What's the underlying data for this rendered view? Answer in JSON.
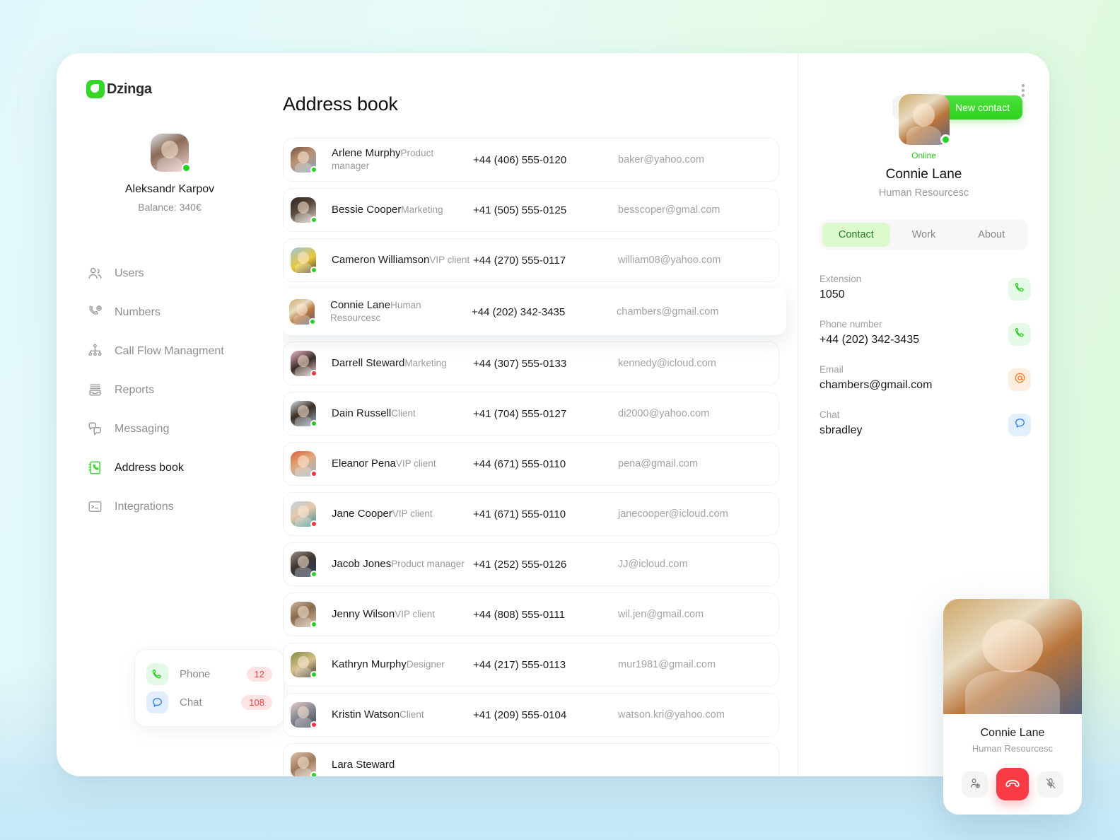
{
  "brand": {
    "name": "Dzinga",
    "accent": "#34d627"
  },
  "profile": {
    "name": "Aleksandr Karpov",
    "balance": "Balance: 340€",
    "status": "online"
  },
  "sidebar": {
    "items": [
      {
        "label": "Users",
        "icon": "users-icon",
        "active": false
      },
      {
        "label": "Numbers",
        "icon": "phone-plus-icon",
        "active": false
      },
      {
        "label": "Call Flow Managment",
        "icon": "call-flow-icon",
        "active": false
      },
      {
        "label": "Reports",
        "icon": "reports-icon",
        "active": false
      },
      {
        "label": "Messaging",
        "icon": "messaging-icon",
        "active": false
      },
      {
        "label": "Address book",
        "icon": "address-book-icon",
        "active": true
      },
      {
        "label": "Integrations",
        "icon": "integrations-icon",
        "active": false
      }
    ],
    "widget": {
      "rows": [
        {
          "label": "Phone",
          "badge": "12",
          "icon": "phone-icon",
          "tone": "green"
        },
        {
          "label": "Chat",
          "badge": "108",
          "icon": "chat-icon",
          "tone": "blue"
        }
      ]
    }
  },
  "header": {
    "title": "Address book",
    "filter_label": "filter-icon",
    "new_contact_label": "New contact"
  },
  "contacts": [
    {
      "name": "Arlene Murphy",
      "role": "Product manager",
      "phone": "+44 (406) 555-0120",
      "email": "baker@yahoo.com",
      "status": "online",
      "avatar": "ph-f1"
    },
    {
      "name": "Bessie Cooper",
      "role": "Marketing",
      "phone": "+41 (505) 555-0125",
      "email": "besscoper@gmal.com",
      "status": "online",
      "avatar": "ph-f2"
    },
    {
      "name": "Cameron Williamson",
      "role": "VIP client",
      "phone": "+44 (270) 555-0117",
      "email": "william08@yahoo.com",
      "status": "online",
      "avatar": "ph-f3"
    },
    {
      "name": "Connie Lane",
      "role": "Human Resourcesc",
      "phone": "+44 (202) 342-3435",
      "email": "chambers@gmail.com",
      "status": "online",
      "avatar": "ph-connie",
      "selected": true
    },
    {
      "name": "Darrell Steward",
      "role": "Marketing",
      "phone": "+44 (307) 555-0133",
      "email": "kennedy@icloud.com",
      "status": "busy",
      "avatar": "ph-f5"
    },
    {
      "name": "Dain Russell",
      "role": "Client",
      "phone": "+41 (704) 555-0127",
      "email": "di2000@yahoo.com",
      "status": "online",
      "avatar": "ph-f6"
    },
    {
      "name": "Eleanor Pena",
      "role": "VIP client",
      "phone": "+44 (671) 555-0110",
      "email": "pena@gmail.com",
      "status": "busy",
      "avatar": "ph-f7"
    },
    {
      "name": "Jane Cooper",
      "role": "VIP client",
      "phone": "+41 (671) 555-0110",
      "email": "janecooper@icloud.com",
      "status": "busy",
      "avatar": "ph-f8"
    },
    {
      "name": "Jacob Jones",
      "role": "Product manager",
      "phone": "+41 (252) 555-0126",
      "email": "JJ@icloud.com",
      "status": "online",
      "avatar": "ph-f9"
    },
    {
      "name": "Jenny Wilson",
      "role": "VIP client",
      "phone": "+44 (808) 555-0111",
      "email": "wil.jen@gmail.com",
      "status": "online",
      "avatar": "ph-f10"
    },
    {
      "name": "Kathryn Murphy",
      "role": "Designer",
      "phone": "+44 (217) 555-0113",
      "email": "mur1981@gmail.com",
      "status": "online",
      "avatar": "ph-f11"
    },
    {
      "name": "Kristin Watson",
      "role": "Client",
      "phone": "+41 (209) 555-0104",
      "email": "watson.kri@yahoo.com",
      "status": "busy",
      "avatar": "ph-f12"
    },
    {
      "name": "Lara Steward",
      "role": "",
      "phone": "",
      "email": "",
      "status": "online",
      "avatar": "ph-f13"
    }
  ],
  "detail": {
    "status": "Online",
    "name": "Connie Lane",
    "role": "Human Resourcesc",
    "tabs": [
      {
        "label": "Contact",
        "active": true
      },
      {
        "label": "Work",
        "active": false
      },
      {
        "label": "About",
        "active": false
      }
    ],
    "fields": [
      {
        "label": "Extension",
        "value": "1050",
        "icon": "phone-icon",
        "tone": "green"
      },
      {
        "label": "Phone number",
        "value": "+44 (202) 342-3435",
        "icon": "phone-icon",
        "tone": "green"
      },
      {
        "label": "Email",
        "value": "chambers@gmail.com",
        "icon": "at-icon",
        "tone": "orange"
      },
      {
        "label": "Chat",
        "value": "sbradley",
        "icon": "chat-icon",
        "tone": "blue"
      }
    ]
  },
  "call_card": {
    "name": "Connie Lane",
    "role": "Human Resourcesc",
    "actions": [
      {
        "name": "add-participant-button",
        "icon": "person-add-icon"
      },
      {
        "name": "hangup-button",
        "icon": "hangup-icon",
        "color": "#f93b45"
      },
      {
        "name": "mute-button",
        "icon": "mic-off-icon"
      }
    ]
  }
}
